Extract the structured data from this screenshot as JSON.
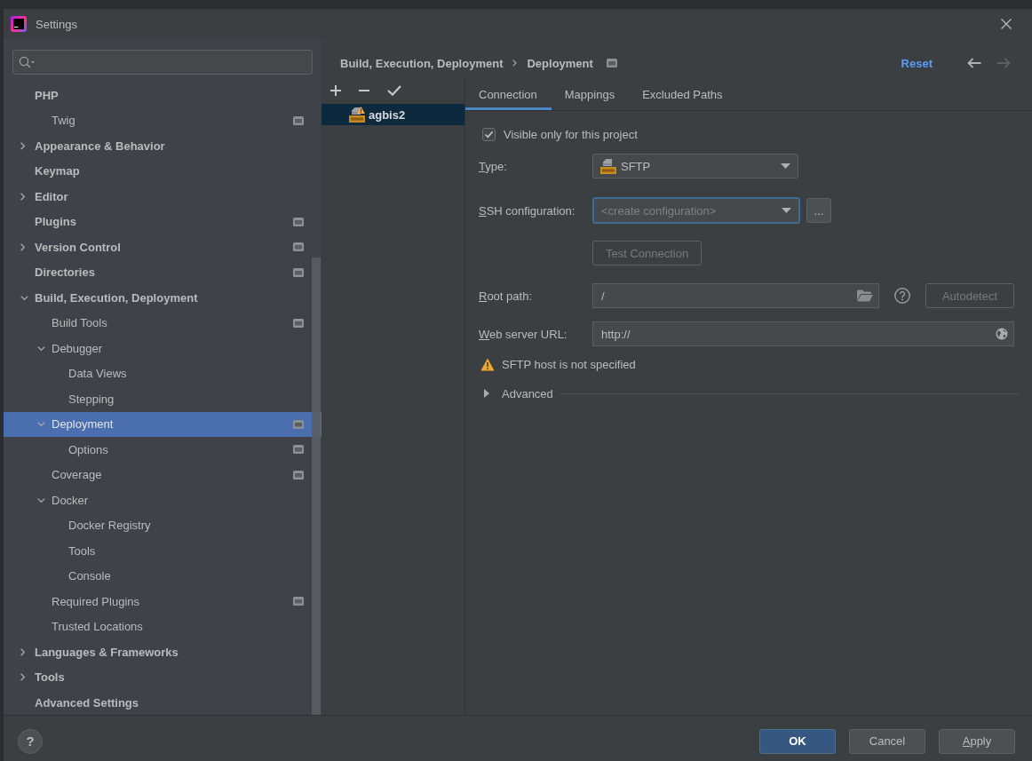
{
  "window": {
    "title": "Settings"
  },
  "tree": [
    {
      "label": "PHP",
      "selected": false,
      "project_level": false,
      "children": [
        {
          "label": "Twig",
          "selected": false,
          "project_level": true
        }
      ]
    },
    {
      "label": "Appearance & Behavior",
      "expanded": false,
      "selected": false,
      "project_level": false
    },
    {
      "label": "Keymap",
      "selected": false,
      "project_level": false
    },
    {
      "label": "Editor",
      "expanded": false,
      "selected": false,
      "project_level": false
    },
    {
      "label": "Plugins",
      "selected": false,
      "project_level": true
    },
    {
      "label": "Version Control",
      "expanded": false,
      "selected": false,
      "project_level": true
    },
    {
      "label": "Directories",
      "selected": false,
      "project_level": true
    },
    {
      "label": "Build, Execution, Deployment",
      "expanded": true,
      "selected": false,
      "project_level": false,
      "children": [
        {
          "label": "Build Tools",
          "selected": false,
          "project_level": true
        },
        {
          "label": "Debugger",
          "expanded": true,
          "selected": false,
          "project_level": false,
          "children": [
            {
              "label": "Data Views",
              "selected": false,
              "project_level": false
            },
            {
              "label": "Stepping",
              "selected": false,
              "project_level": false
            }
          ]
        },
        {
          "label": "Deployment",
          "expanded": true,
          "selected": true,
          "project_level": true,
          "children": [
            {
              "label": "Options",
              "selected": false,
              "project_level": true
            }
          ]
        },
        {
          "label": "Coverage",
          "selected": false,
          "project_level": true
        },
        {
          "label": "Docker",
          "expanded": true,
          "selected": false,
          "project_level": false,
          "children": [
            {
              "label": "Docker Registry",
              "selected": false,
              "project_level": false
            },
            {
              "label": "Tools",
              "selected": false,
              "project_level": false
            },
            {
              "label": "Console",
              "selected": false,
              "project_level": false
            }
          ]
        },
        {
          "label": "Required Plugins",
          "selected": false,
          "project_level": true
        },
        {
          "label": "Trusted Locations",
          "selected": false,
          "project_level": false
        }
      ]
    },
    {
      "label": "Languages & Frameworks",
      "expanded": false,
      "selected": false,
      "project_level": false
    },
    {
      "label": "Tools",
      "expanded": false,
      "selected": false,
      "project_level": false
    },
    {
      "label": "Advanced Settings",
      "selected": false,
      "project_level": false
    }
  ],
  "breadcrumb": {
    "items": [
      "Build, Execution, Deployment",
      "Deployment"
    ],
    "project_level": true
  },
  "header_actions": {
    "reset": "Reset",
    "back": {
      "disabled": false
    },
    "forward": {
      "disabled": true
    }
  },
  "servers": [
    {
      "name": "agbis2",
      "warning": true,
      "selected": true
    }
  ],
  "tabs": [
    {
      "label": "Connection",
      "selected": true
    },
    {
      "label": "Mappings",
      "selected": false
    },
    {
      "label": "Excluded Paths",
      "selected": false
    }
  ],
  "connection": {
    "visible_only": {
      "label": "Visible only for this project",
      "checked": true
    },
    "type": {
      "label": "Type:",
      "value": "SFTP"
    },
    "ssh": {
      "label": "SSH configuration:",
      "placeholder": "<create configuration>",
      "focused": true,
      "browse": "..."
    },
    "test_button": {
      "label": "Test Connection",
      "disabled": true
    },
    "root_path": {
      "label": "Root path:",
      "value": "/"
    },
    "autodetect": {
      "label": "Autodetect",
      "disabled": true
    },
    "web_url": {
      "label": "Web server URL:",
      "value": "http://"
    },
    "warning": "SFTP host is not specified",
    "advanced": {
      "label": "Advanced",
      "expanded": false
    }
  },
  "footer": {
    "help": "?",
    "buttons": [
      {
        "label": "OK",
        "kind": "default",
        "mnemonic": false
      },
      {
        "label": "Cancel",
        "kind": "normal",
        "mnemonic": false
      },
      {
        "label": "Apply",
        "kind": "normal",
        "mnemonic": true
      }
    ]
  }
}
